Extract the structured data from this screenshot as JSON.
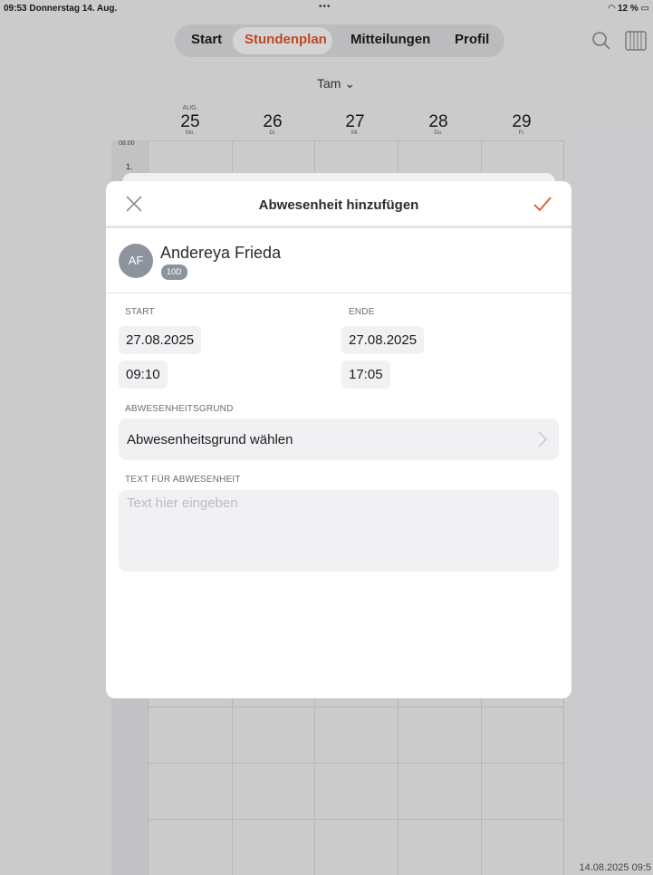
{
  "status_bar": {
    "time": "09:53",
    "date": "Donnerstag 14. Aug.",
    "dots": "•••",
    "battery": "12 %"
  },
  "nav": {
    "tabs": [
      {
        "label": "Start",
        "active": false
      },
      {
        "label": "Stundenplan",
        "active": true
      },
      {
        "label": "Mitteilungen",
        "active": false
      },
      {
        "label": "Profil",
        "active": false
      }
    ],
    "icons": [
      "search-icon",
      "columns-icon"
    ]
  },
  "timetable": {
    "person_selector": "Tam ⌄",
    "days": [
      {
        "month": "AUG.",
        "num": "25",
        "weekday": "Mo."
      },
      {
        "month": "",
        "num": "26",
        "weekday": "Di."
      },
      {
        "month": "",
        "num": "27",
        "weekday": "Mi."
      },
      {
        "month": "",
        "num": "28",
        "weekday": "Do."
      },
      {
        "month": "",
        "num": "29",
        "weekday": "Fr."
      }
    ],
    "start_time": "08:00",
    "lesson": "1.",
    "footer_timestamp": "14.08.2025 09:5"
  },
  "modal": {
    "title": "Abwesenheit hinzufügen",
    "person": {
      "initials": "AF",
      "name": "Andereya Frieda",
      "class": "10D"
    },
    "start_label": "START",
    "end_label": "ENDE",
    "start_date": "27.08.2025",
    "start_time": "09:10",
    "end_date": "27.08.2025",
    "end_time": "17:05",
    "reason_label": "ABWESENHEITSGRUND",
    "reason_value": "Abwesenheitsgrund wählen",
    "text_label": "TEXT FÜR ABWESENHEIT",
    "text_placeholder": "Text hier eingeben",
    "accent_color": "#e4572e"
  }
}
